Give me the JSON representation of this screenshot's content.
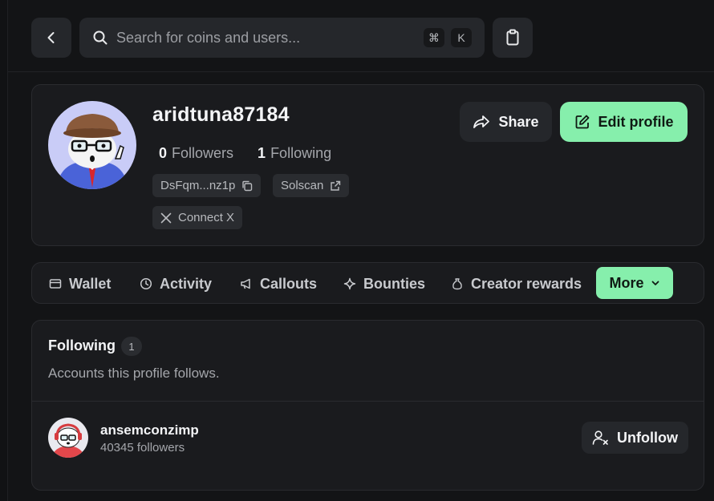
{
  "topbar": {
    "search_placeholder": "Search for coins and users...",
    "shortcut_cmd": "⌘",
    "shortcut_key": "K"
  },
  "profile": {
    "username": "aridtuna87184",
    "followers_count": "0",
    "followers_label": "Followers",
    "following_count": "1",
    "following_label": "Following",
    "address": "DsFqm...nz1p",
    "solscan_label": "Solscan",
    "connect_x_label": "Connect X",
    "share_label": "Share",
    "edit_label": "Edit profile"
  },
  "tabs": [
    {
      "label": "Wallet",
      "icon": "wallet-icon"
    },
    {
      "label": "Activity",
      "icon": "clock-icon"
    },
    {
      "label": "Callouts",
      "icon": "megaphone-icon"
    },
    {
      "label": "Bounties",
      "icon": "sparkle-icon"
    },
    {
      "label": "Creator rewards",
      "icon": "money-bag-icon"
    }
  ],
  "more_label": "More",
  "following_section": {
    "title": "Following",
    "count": "1",
    "description": "Accounts this profile follows.",
    "users": [
      {
        "name": "ansemconzimp",
        "followers": "40345 followers",
        "action": "Unfollow"
      }
    ]
  },
  "colors": {
    "accent": "#86efac",
    "background": "#131416",
    "card": "#1a1b1e",
    "button": "#25272b"
  }
}
